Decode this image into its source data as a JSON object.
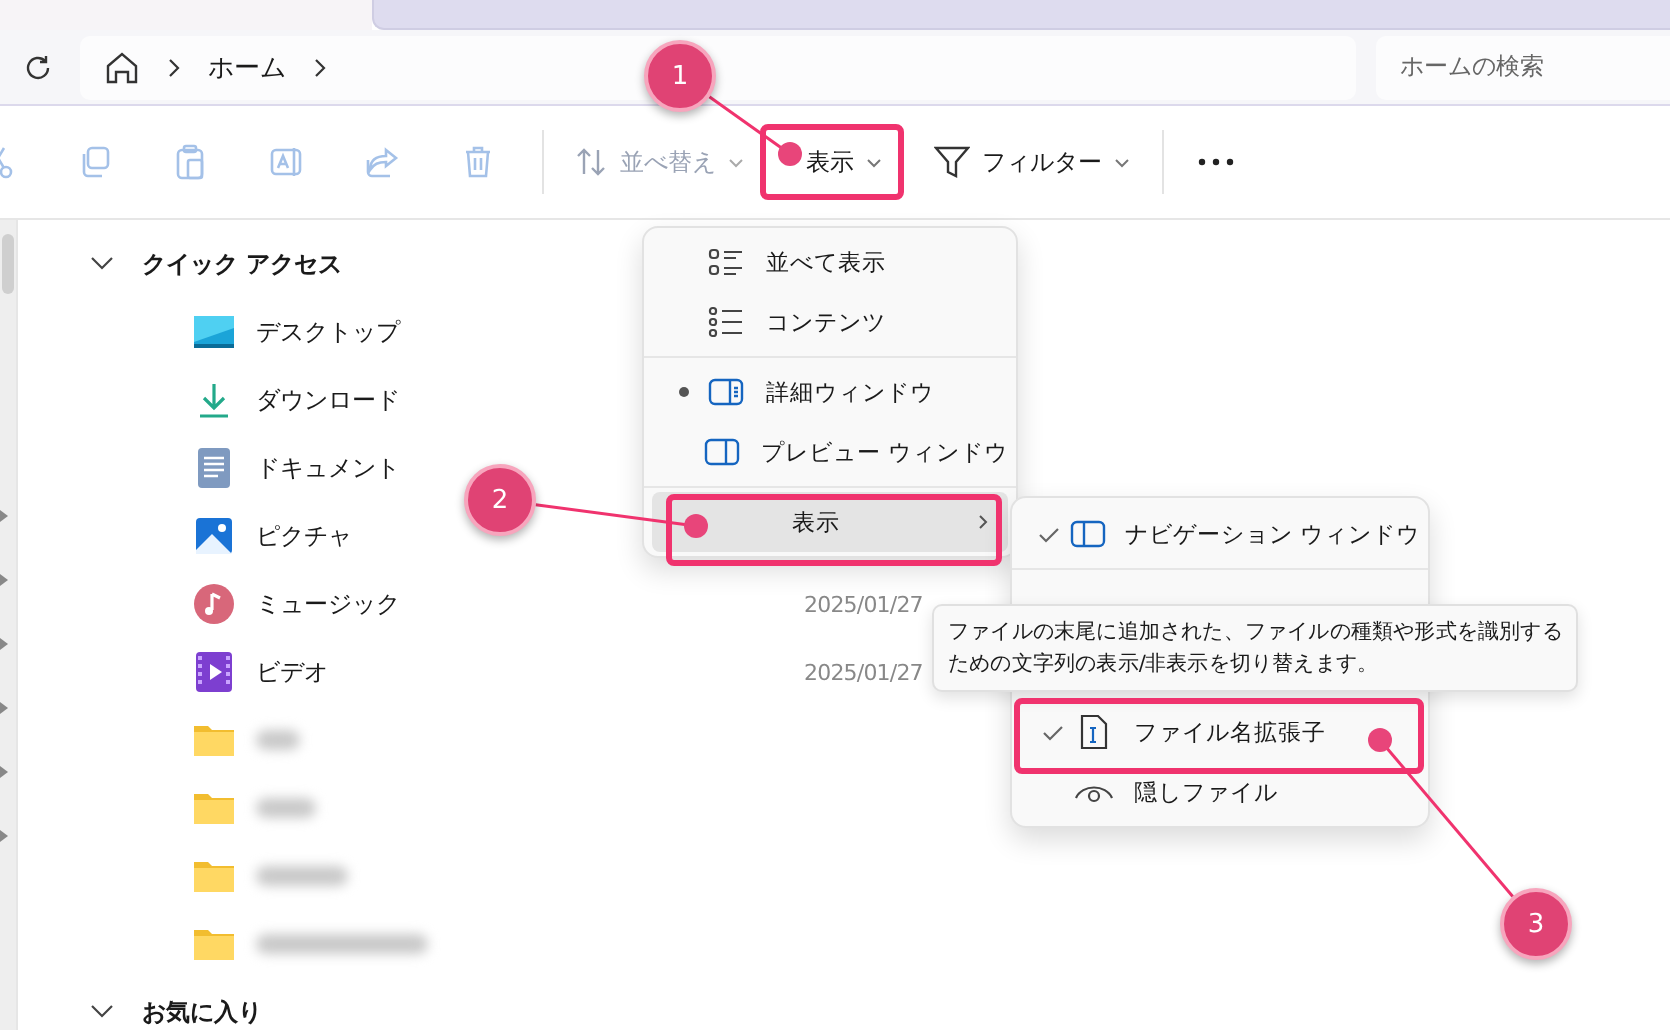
{
  "address_bar": {
    "crumbs": [
      "ホーム"
    ]
  },
  "search": {
    "placeholder": "ホームの検索"
  },
  "toolbar": {
    "actions": [
      {
        "kind": "cut",
        "disabled": true
      },
      {
        "kind": "copy",
        "disabled": true
      },
      {
        "kind": "paste",
        "disabled": true
      },
      {
        "kind": "rename",
        "disabled": true
      },
      {
        "kind": "share",
        "disabled": true
      },
      {
        "kind": "delete",
        "disabled": true
      }
    ],
    "sort_button": {
      "label": "並べ替え",
      "disabled": true
    },
    "view_button": {
      "label": "表示"
    },
    "filter_button": {
      "label": "フィルター"
    }
  },
  "nav": {
    "sections": [
      {
        "label": "クイック アクセス",
        "expanded": true,
        "items": [
          {
            "label": "デスクトップ",
            "kind": "desktop"
          },
          {
            "label": "ダウンロード",
            "kind": "downloads"
          },
          {
            "label": "ドキュメント",
            "kind": "documents"
          },
          {
            "label": "ピクチャ",
            "kind": "pictures"
          },
          {
            "label": "ミュージック",
            "kind": "music",
            "modified": "2025/01/27"
          },
          {
            "label": "ビデオ",
            "kind": "videos",
            "modified": "2025/01/27"
          },
          {
            "kind": "folder"
          },
          {
            "kind": "folder"
          },
          {
            "kind": "folder"
          },
          {
            "kind": "folder"
          }
        ]
      },
      {
        "label": "お気に入り",
        "expanded": true
      }
    ]
  },
  "view_menu": {
    "groups": [
      {
        "items": [
          {
            "label": "並べて表示",
            "kind": "tiles",
            "selected": false
          },
          {
            "label": "コンテンツ",
            "kind": "content",
            "selected": false
          }
        ]
      },
      {
        "items": [
          {
            "label": "詳細ウィンドウ",
            "kind": "details_pane",
            "selected": true
          },
          {
            "label": "プレビュー ウィンドウ",
            "kind": "preview_pane",
            "selected": false
          }
        ]
      },
      {
        "items": [
          {
            "label": "表示",
            "kind": "submenu",
            "highlighted": true
          }
        ]
      }
    ]
  },
  "show_submenu": {
    "groups": [
      {
        "items": [
          {
            "label": "ナビゲーション ウィンドウ",
            "kind": "nav_pane",
            "checked": true
          }
        ]
      },
      {
        "items": [
          {
            "label": "ファイル名拡張子",
            "kind": "extensions",
            "checked": true
          },
          {
            "label": "隠しファイル",
            "kind": "hidden",
            "checked": false
          }
        ]
      }
    ]
  },
  "tooltip": {
    "lines": [
      "ファイルの末尾に追加された、ファイルの種類や形式を識別する",
      "ための文字列の表示/非表示を切り替えます。"
    ]
  },
  "annotations": [
    {
      "number": "1"
    },
    {
      "number": "2"
    },
    {
      "number": "3"
    }
  ]
}
